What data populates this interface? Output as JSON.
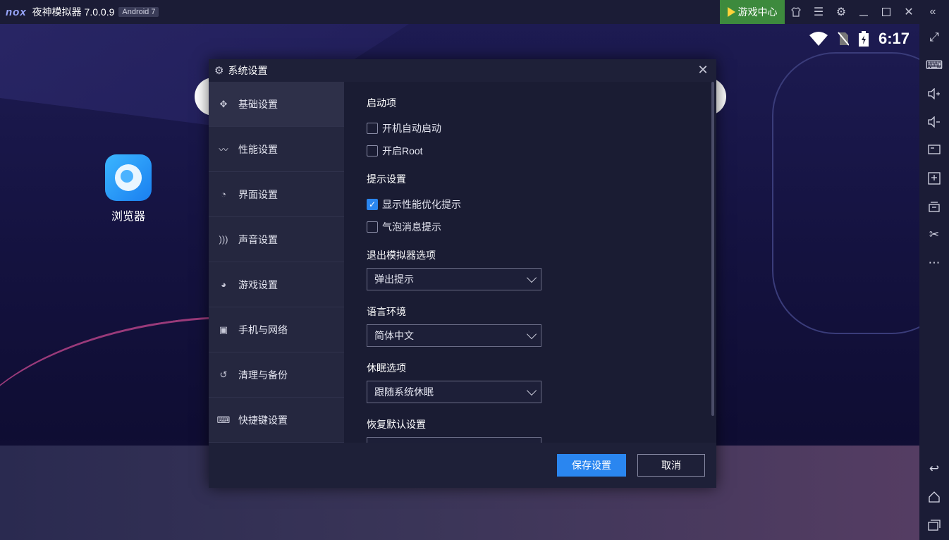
{
  "window": {
    "logo": "nox",
    "title": "夜神模拟器 7.0.0.9",
    "android_badge": "Android 7",
    "game_center": "游戏中心"
  },
  "status_bar": {
    "time": "6:17"
  },
  "desktop": {
    "app_label": "浏览器"
  },
  "dialog": {
    "title": "系统设置",
    "nav": [
      {
        "label": "基础设置",
        "icon": "puzzle-icon"
      },
      {
        "label": "性能设置",
        "icon": "pulse-icon"
      },
      {
        "label": "界面设置",
        "icon": "palette-icon"
      },
      {
        "label": "声音设置",
        "icon": "sound-icon"
      },
      {
        "label": "游戏设置",
        "icon": "game-icon"
      },
      {
        "label": "手机与网络",
        "icon": "phone-icon"
      },
      {
        "label": "清理与备份",
        "icon": "history-icon"
      },
      {
        "label": "快捷键设置",
        "icon": "keyboard-icon"
      }
    ],
    "sections": {
      "startup": "启动项",
      "auto_start": "开机自动启动",
      "root": "开启Root",
      "tips": "提示设置",
      "perf_tip": "显示性能优化提示",
      "bubble_tip": "气泡消息提示",
      "exit_option": "退出模拟器选项",
      "exit_value": "弹出提示",
      "language": "语言环境",
      "language_value": "简体中文",
      "sleep": "休眠选项",
      "sleep_value": "跟随系统休眠",
      "restore": "恢复默认设置"
    },
    "checks": {
      "auto_start": false,
      "root": false,
      "perf_tip": true,
      "bubble_tip": false
    },
    "save": "保存设置",
    "cancel": "取消"
  }
}
